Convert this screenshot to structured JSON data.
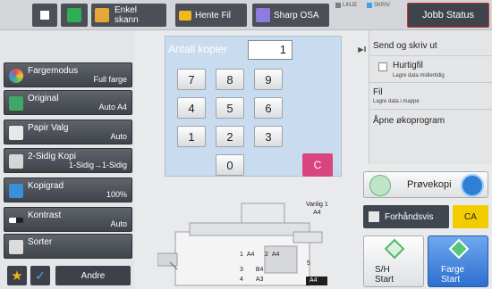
{
  "topbar": {
    "enkel_label": "Enkel skann",
    "hente_label": "Hente Fil",
    "sharp_label": "Sharp OSA",
    "linje": "LINJE",
    "skriv": "SKRIV",
    "jobb_status": "Jobb Status",
    "icons": [
      "home-icon",
      "scan-icon",
      "folder-icon",
      "sharp-osa-icon"
    ]
  },
  "functions": [
    {
      "name": "Fargemodus",
      "value": "Full farge",
      "icon": "color-mode-icon"
    },
    {
      "name": "Original",
      "value": "Auto  A4",
      "icon": "original-icon"
    },
    {
      "name": "Papir Valg",
      "value": "Auto",
      "icon": "paper-icon"
    },
    {
      "name": "2-Sidig Kopi",
      "value": "1-Sidig→1-Sidig",
      "icon": "duplex-icon"
    },
    {
      "name": "Kopigrad",
      "value": "100%",
      "icon": "ratio-icon"
    },
    {
      "name": "Kontrast",
      "value": "Auto",
      "icon": "contrast-icon"
    },
    {
      "name": "Sorter",
      "value": "",
      "icon": "sort-icon"
    }
  ],
  "bottom": {
    "andre": "Andre"
  },
  "keypad": {
    "title": "Antall kopier",
    "value": "1",
    "keys": [
      "7",
      "8",
      "9",
      "4",
      "5",
      "6",
      "1",
      "2",
      "3",
      "0"
    ],
    "clear": "C"
  },
  "menu": {
    "send": "Send og skriv ut",
    "hurtigfil": "Hurtigfil",
    "hurtigfil_sub": "Lagre data midlertidig",
    "fil": "Fil",
    "fil_sub": "Lagre data i mappe",
    "apne": "Åpne økoprogram"
  },
  "actions": {
    "provekopi": "Prøvekopi",
    "forhandsvis": "Forhåndsvis",
    "ca": "CA",
    "sh_label": "S/H",
    "sh_start": "Start",
    "farge_label": "Farge",
    "farge_start": "Start"
  },
  "machine": {
    "vanlig": "Vanlig 1",
    "vanlig_size": "A4",
    "tray1": "1",
    "tray2": "2",
    "tray3": "3",
    "tray4": "4",
    "tray5": "5",
    "t1_size": "A4",
    "t2_size": "A4",
    "t3_size": "B4",
    "t4_size": "A3",
    "t5_size": "A4"
  },
  "colors": {
    "accent": "#d8457f",
    "jobb_border": "#cc3333",
    "ca": "#f1cd00",
    "start_blue": "#2e6fcf"
  }
}
